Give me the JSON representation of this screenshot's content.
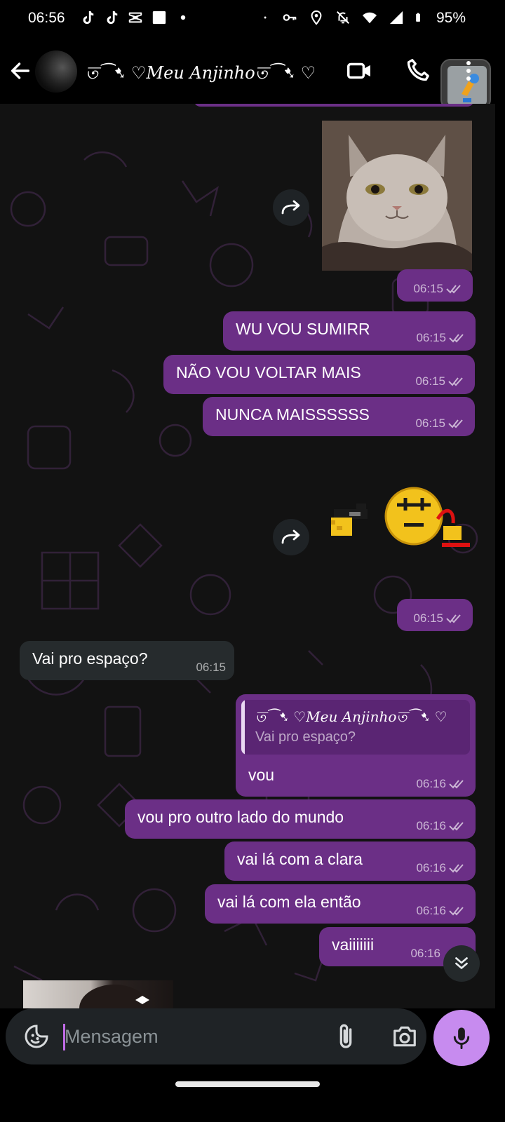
{
  "status_bar": {
    "time": "06:56",
    "battery": "95%",
    "left_icons": [
      "tiktok-icon",
      "tiktok-icon",
      "capcut-icon",
      "square-notification-icon",
      "dot-icon"
    ],
    "right_icons": [
      "dot-icon",
      "vpn-key-icon",
      "location-icon",
      "bell-off-icon",
      "wifi-icon",
      "signal-icon",
      "battery-icon"
    ]
  },
  "header": {
    "contact_name": "ত⁀➷ ♡Meu Anjinhoত⁀➷ ♡",
    "icons": [
      "back-arrow-icon",
      "video-call-icon",
      "voice-call-icon",
      "more-options-icon"
    ]
  },
  "messages": [
    {
      "kind": "image",
      "direction": "out",
      "time": "06:15",
      "description_icon": "cat-photo"
    },
    {
      "kind": "text",
      "direction": "out",
      "text": "WU VOU SUMIRR",
      "time": "06:15"
    },
    {
      "kind": "text",
      "direction": "out",
      "text": "NÃO VOU VOLTAR MAIS",
      "time": "06:15"
    },
    {
      "kind": "text",
      "direction": "out",
      "text": "NUNCA MAISSSSSS",
      "time": "06:15"
    },
    {
      "kind": "sticker",
      "direction": "out",
      "time": "06:15"
    },
    {
      "kind": "text",
      "direction": "in",
      "text": "Vai pro espaço?",
      "time": "06:15"
    },
    {
      "kind": "reply",
      "direction": "out",
      "quoted_name": "ত⁀➷ ♡Meu Anjinhoত⁀➷ ♡",
      "quoted_text": "Vai pro espaço?",
      "text": "vou",
      "time": "06:16"
    },
    {
      "kind": "text",
      "direction": "out",
      "text": "vou pro outro lado do mundo",
      "time": "06:16"
    },
    {
      "kind": "text",
      "direction": "out",
      "text": "vai lá com a clara",
      "time": "06:16"
    },
    {
      "kind": "text",
      "direction": "out",
      "text": "vai lá com ela então",
      "time": "06:16"
    },
    {
      "kind": "text",
      "direction": "out",
      "text": "vaiiiiiii",
      "time": "06:16"
    }
  ],
  "input": {
    "placeholder": "Mensagem",
    "value": ""
  },
  "colors": {
    "outgoing_bubble": "#6b2f86",
    "incoming_bubble": "#262b2d",
    "mic_button": "#c78bef",
    "background": "#121212"
  }
}
